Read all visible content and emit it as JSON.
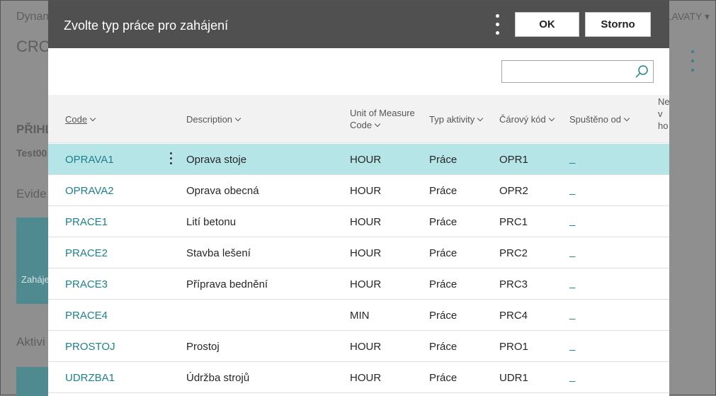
{
  "background": {
    "app_name": "Dynam",
    "page_title": "CRO",
    "section_heading": "PŘIHL",
    "sub_value": "Test00",
    "evid_heading": "Evide",
    "tile_label": "Zaháje",
    "aktiv_heading": "Aktivi",
    "user_name": "LAVATY ▾"
  },
  "dialog": {
    "title": "Zvolte typ práce pro zahájení",
    "ok_label": "OK",
    "cancel_label": "Storno",
    "search": {
      "value": "",
      "placeholder": ""
    }
  },
  "table": {
    "headers": {
      "code": "Code",
      "description": "Description",
      "uom_line1": "Unit of Measure",
      "uom_line2": "Code",
      "typ_aktivity": "Typ aktivity",
      "carovy_kod": "Čárový kód",
      "spusteno_od": "Spuštěno od",
      "ne_line1": "Ne",
      "ne_line2": "v",
      "ne_line3": "ho"
    },
    "rows": [
      {
        "code": "OPRAVA1",
        "description": "Oprava stoje",
        "uom": "HOUR",
        "typ": "Práce",
        "carovy": "OPR1",
        "spusteno": "_"
      },
      {
        "code": "OPRAVA2",
        "description": "Oprava obecná",
        "uom": "HOUR",
        "typ": "Práce",
        "carovy": "OPR2",
        "spusteno": "_"
      },
      {
        "code": "PRACE1",
        "description": "Lití betonu",
        "uom": "HOUR",
        "typ": "Práce",
        "carovy": "PRC1",
        "spusteno": "_"
      },
      {
        "code": "PRACE2",
        "description": "Stavba lešení",
        "uom": "HOUR",
        "typ": "Práce",
        "carovy": "PRC2",
        "spusteno": "_"
      },
      {
        "code": "PRACE3",
        "description": "Příprava bednění",
        "uom": "HOUR",
        "typ": "Práce",
        "carovy": "PRC3",
        "spusteno": "_"
      },
      {
        "code": "PRACE4",
        "description": "",
        "uom": "MIN",
        "typ": "Práce",
        "carovy": "PRC4",
        "spusteno": "_"
      },
      {
        "code": "PROSTOJ",
        "description": "Prostoj",
        "uom": "HOUR",
        "typ": "Práce",
        "carovy": "PRO1",
        "spusteno": "_"
      },
      {
        "code": "UDRZBA1",
        "description": "Údržba strojů",
        "uom": "HOUR",
        "typ": "Práce",
        "carovy": "UDR1",
        "spusteno": "_"
      }
    ]
  },
  "colors": {
    "header_bg": "#505050",
    "selected_row": "#b6e5e8",
    "link": "#1e8189",
    "overlay": "#8f8f8f"
  }
}
